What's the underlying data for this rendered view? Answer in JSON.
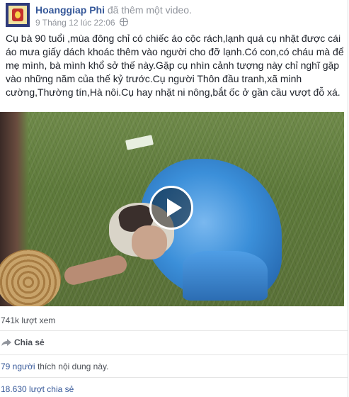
{
  "post": {
    "author": "Hoanggiap Phi",
    "action": "đã thêm một video.",
    "date": "9 Tháng 12 lúc 22:06",
    "text": "Cụ bà 90 tuổi ,mùa đông chỉ có chiếc áo cộc rách,lạnh quá cụ nhặt được cái áo mưa giấy dách khoác thêm vào người cho đỡ lạnh.Có con,có cháu mà để mẹ mình, bà mình khổ sở thế này.Gặp cụ nhìn cảnh tượng này chỉ nghĩ gặp vào những năm của thế kỷ trước.Cụ người Thôn đầu tranh,xã minh cường,Thường tín,Hà nôi.Cụ hay nhặt ni nông,bắt ốc ở gần cầu vượt đỗ xá."
  },
  "video": {
    "views": "741k lượt xem",
    "play_icon": "play-icon"
  },
  "footer": {
    "share_label": "Chia sẻ",
    "likes_count": "79 người",
    "likes_suffix": "thích nội dung này.",
    "shares": "18.630 lượt chia sẻ"
  },
  "colors": {
    "link": "#365899",
    "meta": "#90949c",
    "text": "#1d2129"
  }
}
